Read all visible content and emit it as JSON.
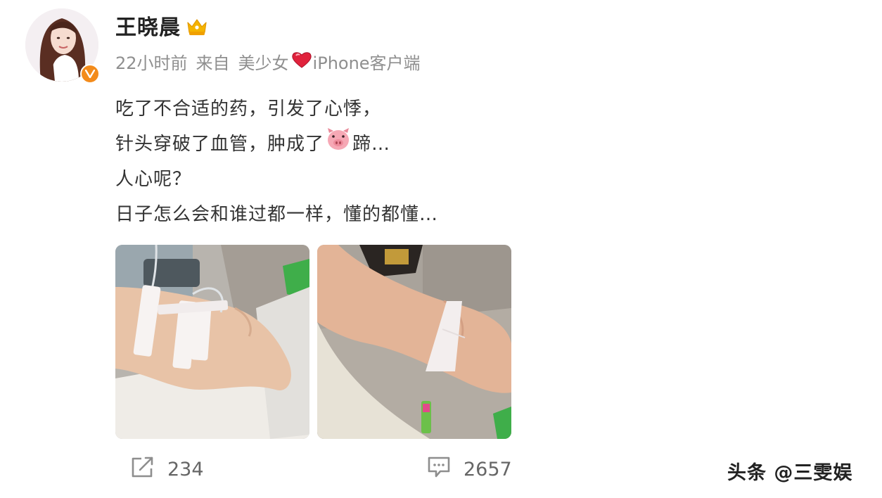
{
  "post": {
    "author": {
      "name": "王晓晨",
      "avatar_icon": "avatar-woman-photo",
      "badge_icon": "crown-icon",
      "verified_icon": "verified-v-icon",
      "verified_color": "#f38b1b"
    },
    "meta": {
      "time": "22小时前",
      "source_prefix": "来自",
      "source_name": "美少女",
      "source_icon": "heart-icon",
      "source_suffix": "iPhone客户端"
    },
    "text_lines": [
      "吃了不合适的药，引发了心悸，",
      "针头穿破了血管，肿成了",
      "人心呢？",
      "日子怎么会和谁过都一样，懂的都懂…"
    ],
    "text_line_2_emoji": "pig-face-emoji",
    "text_line_2_tail": "蹄…",
    "photos": [
      {
        "icon": "photo-iv-taped-hand"
      },
      {
        "icon": "photo-taped-wrist"
      }
    ],
    "actions": {
      "repost_icon": "repost-icon",
      "repost_count": "234",
      "comment_icon": "comment-icon",
      "comment_count": "2657"
    }
  },
  "watermark": "头条 @三雯娱"
}
